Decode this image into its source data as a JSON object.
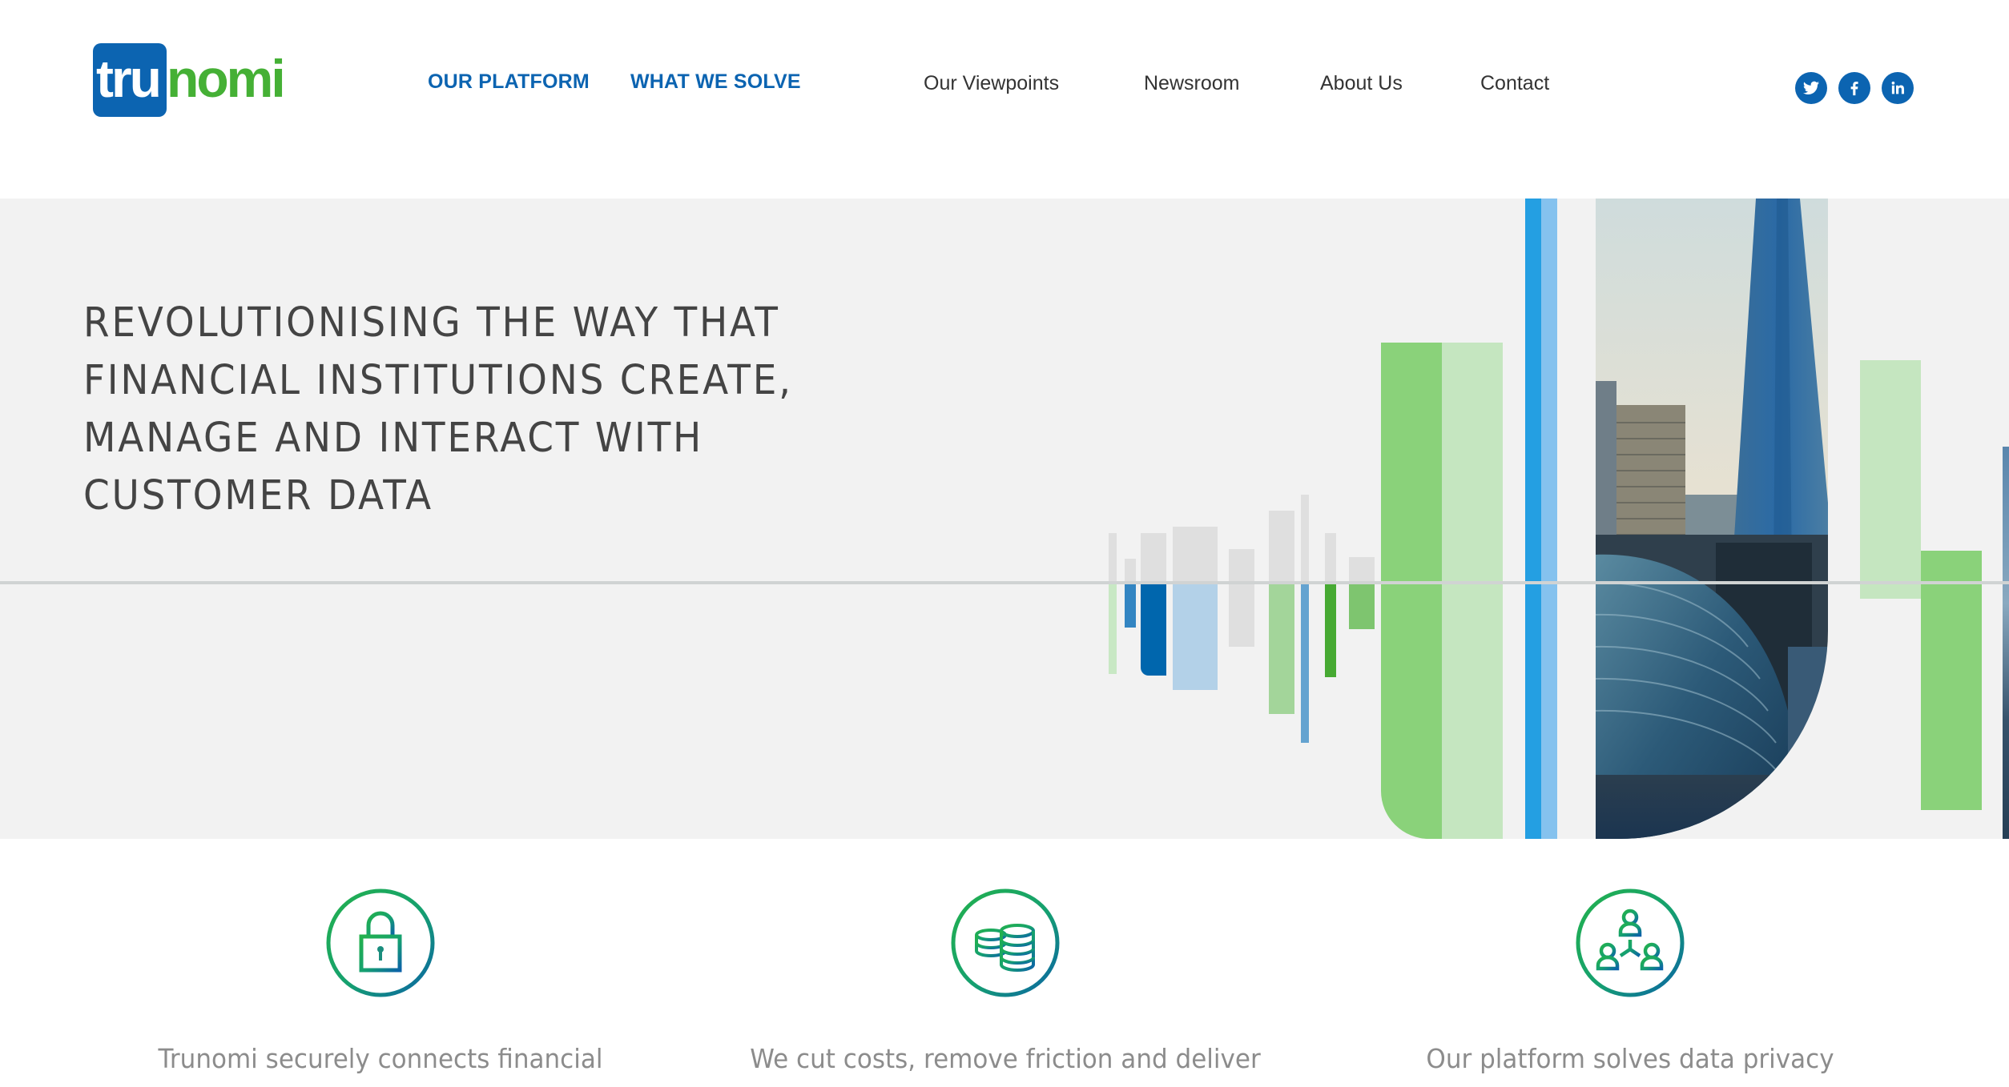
{
  "brand": {
    "logo_part1": "tru",
    "logo_part2": "nomi",
    "primary_color": "#0c64b1",
    "accent_color": "#45b035"
  },
  "nav": {
    "primary": [
      {
        "label": "OUR PLATFORM"
      },
      {
        "label": "WHAT WE SOLVE"
      }
    ],
    "secondary": [
      {
        "label": "Our Viewpoints"
      },
      {
        "label": "Newsroom"
      },
      {
        "label": "About Us"
      },
      {
        "label": "Contact"
      }
    ],
    "social": [
      {
        "name": "twitter-icon"
      },
      {
        "name": "facebook-icon"
      },
      {
        "name": "linkedin-icon"
      }
    ]
  },
  "hero": {
    "headline_lines": [
      "REVOLUTIONISING THE WAY THAT",
      "FINANCIAL INSTITUTIONS CREATE,",
      "MANAGE AND INTERACT WITH",
      "CUSTOMER DATA"
    ],
    "background_color": "#f2f2f2"
  },
  "features": [
    {
      "icon": "padlock-icon",
      "text": "Trunomi securely connects financial"
    },
    {
      "icon": "coin-stack-icon",
      "text": "We cut costs, remove friction and deliver"
    },
    {
      "icon": "user-network-icon",
      "text": "Our platform solves data privacy"
    }
  ]
}
